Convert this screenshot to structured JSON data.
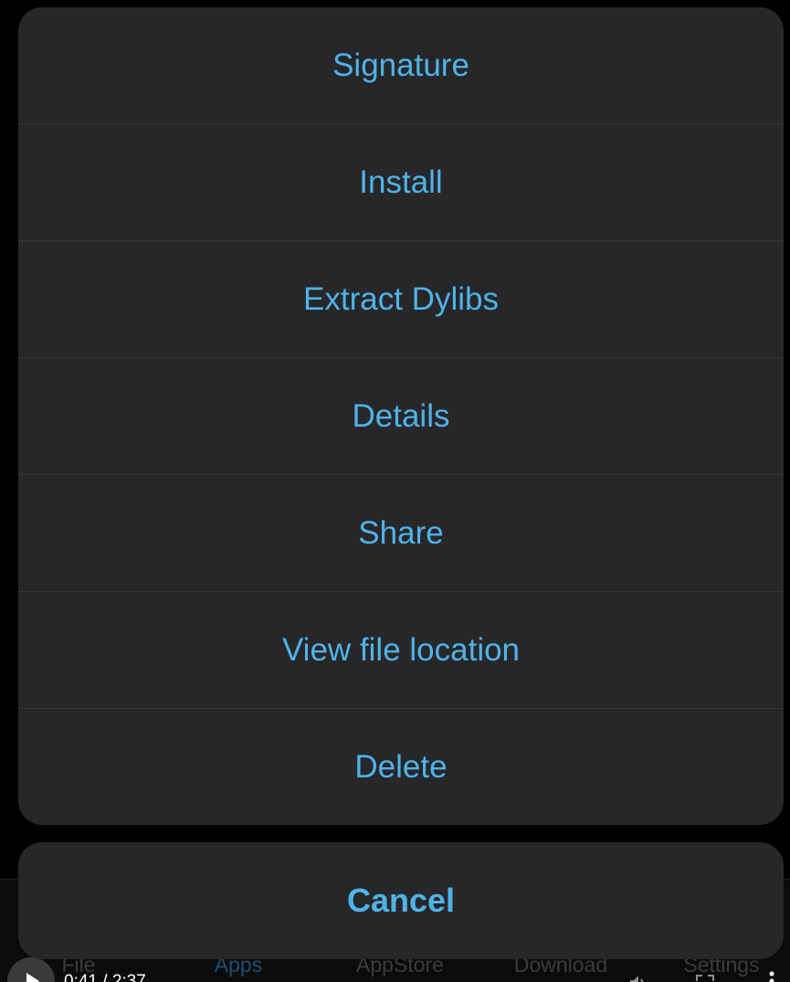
{
  "action_sheet": {
    "actions": [
      {
        "label": "Signature"
      },
      {
        "label": "Install"
      },
      {
        "label": "Extract Dylibs"
      },
      {
        "label": "Details"
      },
      {
        "label": "Share"
      },
      {
        "label": "View file location"
      },
      {
        "label": "Delete"
      }
    ],
    "cancel_label": "Cancel"
  },
  "tab_bar": {
    "tabs": [
      {
        "label": "File"
      },
      {
        "label": "Apps",
        "active": true
      },
      {
        "label": "AppStore"
      },
      {
        "label": "Download"
      },
      {
        "label": "Settings"
      }
    ]
  },
  "player": {
    "time": "0:41 / 2:37",
    "icons": [
      "play-icon",
      "volume-icon",
      "fullscreen-icon",
      "more-icon"
    ]
  },
  "colors": {
    "accent": "#4fb3e8",
    "sheet_bg": "#272629",
    "separator": "#37363a",
    "background": "#000000"
  }
}
